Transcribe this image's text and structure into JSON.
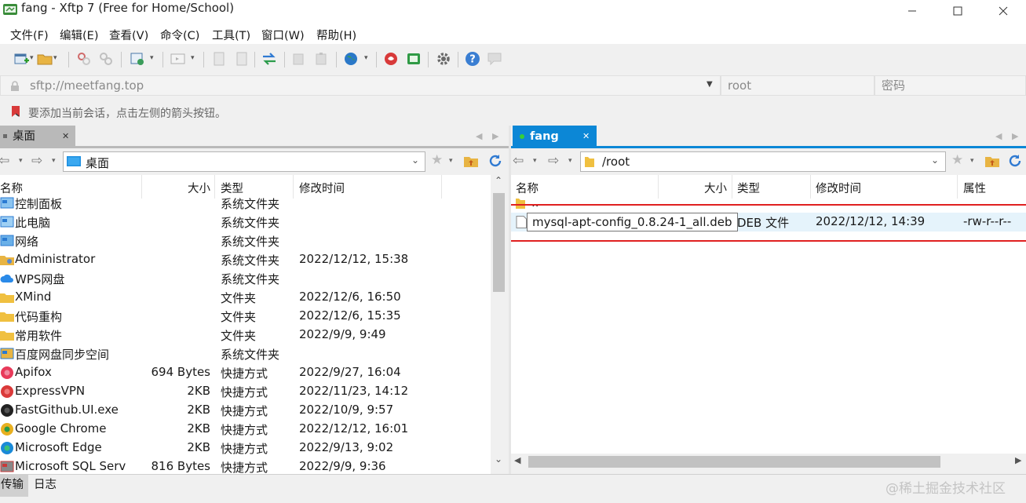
{
  "window": {
    "title": "fang - Xftp 7 (Free for Home/School)",
    "minimize": "—",
    "maximize": "☐",
    "close": "✕"
  },
  "menu": [
    "文件(F)",
    "编辑(E)",
    "查看(V)",
    "命令(C)",
    "工具(T)",
    "窗口(W)",
    "帮助(H)"
  ],
  "address": {
    "url": "sftp://meetfang.top",
    "user_placeholder": "root",
    "password_placeholder": "密码"
  },
  "info": "要添加当前会话，点击左侧的箭头按钮。",
  "local": {
    "tab_label": "桌面",
    "path": "桌面",
    "columns": [
      "名称",
      "大小",
      "类型",
      "修改时间"
    ],
    "files": [
      {
        "name": "控制面板",
        "size": "",
        "type": "系统文件夹",
        "modified": "",
        "icon": "control-panel-icon"
      },
      {
        "name": "此电脑",
        "size": "",
        "type": "系统文件夹",
        "modified": "",
        "icon": "computer-icon"
      },
      {
        "name": "网络",
        "size": "",
        "type": "系统文件夹",
        "modified": "",
        "icon": "network-icon"
      },
      {
        "name": "Administrator",
        "size": "",
        "type": "系统文件夹",
        "modified": "2022/12/12, 15:38",
        "icon": "user-folder-icon"
      },
      {
        "name": "WPS网盘",
        "size": "",
        "type": "系统文件夹",
        "modified": "",
        "icon": "cloud-icon"
      },
      {
        "name": "XMind",
        "size": "",
        "type": "文件夹",
        "modified": "2022/12/6, 16:50",
        "icon": "folder-icon"
      },
      {
        "name": "代码重构",
        "size": "",
        "type": "文件夹",
        "modified": "2022/12/6, 15:35",
        "icon": "folder-icon"
      },
      {
        "name": "常用软件",
        "size": "",
        "type": "文件夹",
        "modified": "2022/9/9, 9:49",
        "icon": "folder-icon"
      },
      {
        "name": "百度网盘同步空间",
        "size": "",
        "type": "系统文件夹",
        "modified": "",
        "icon": "baidu-sync-icon"
      },
      {
        "name": "Apifox",
        "size": "694 Bytes",
        "type": "快捷方式",
        "modified": "2022/9/27, 16:04",
        "icon": "apifox-icon"
      },
      {
        "name": "ExpressVPN",
        "size": "2KB",
        "type": "快捷方式",
        "modified": "2022/11/23, 14:12",
        "icon": "expressvpn-icon"
      },
      {
        "name": "FastGithub.UI.exe",
        "size": "2KB",
        "type": "快捷方式",
        "modified": "2022/10/9, 9:57",
        "icon": "github-icon"
      },
      {
        "name": "Google Chrome",
        "size": "2KB",
        "type": "快捷方式",
        "modified": "2022/12/12, 16:01",
        "icon": "chrome-icon"
      },
      {
        "name": "Microsoft Edge",
        "size": "2KB",
        "type": "快捷方式",
        "modified": "2022/9/13, 9:02",
        "icon": "edge-icon"
      },
      {
        "name": "Microsoft SQL Serv",
        "size": "816 Bytes",
        "type": "快捷方式",
        "modified": "2022/9/9, 9:36",
        "icon": "sql-server-icon"
      }
    ]
  },
  "remote": {
    "tab_label": "fang",
    "path": "/root",
    "columns": [
      "名称",
      "大小",
      "类型",
      "修改时间",
      "属性"
    ],
    "parent": "..",
    "files": [
      {
        "name": "mysql-apt-config_0.8.24-1_all.deb",
        "size": "",
        "type": "DEB 文件",
        "modified": "2022/12/12, 14:39",
        "attr": "-rw-r--r--"
      }
    ]
  },
  "bottom_tabs": [
    "传输",
    "日志"
  ],
  "watermark": "@稀土掘金技术社区",
  "colors": {
    "accent": "#0c87d6",
    "selection": "#cce8ff",
    "highlight_box": "#e02020"
  }
}
